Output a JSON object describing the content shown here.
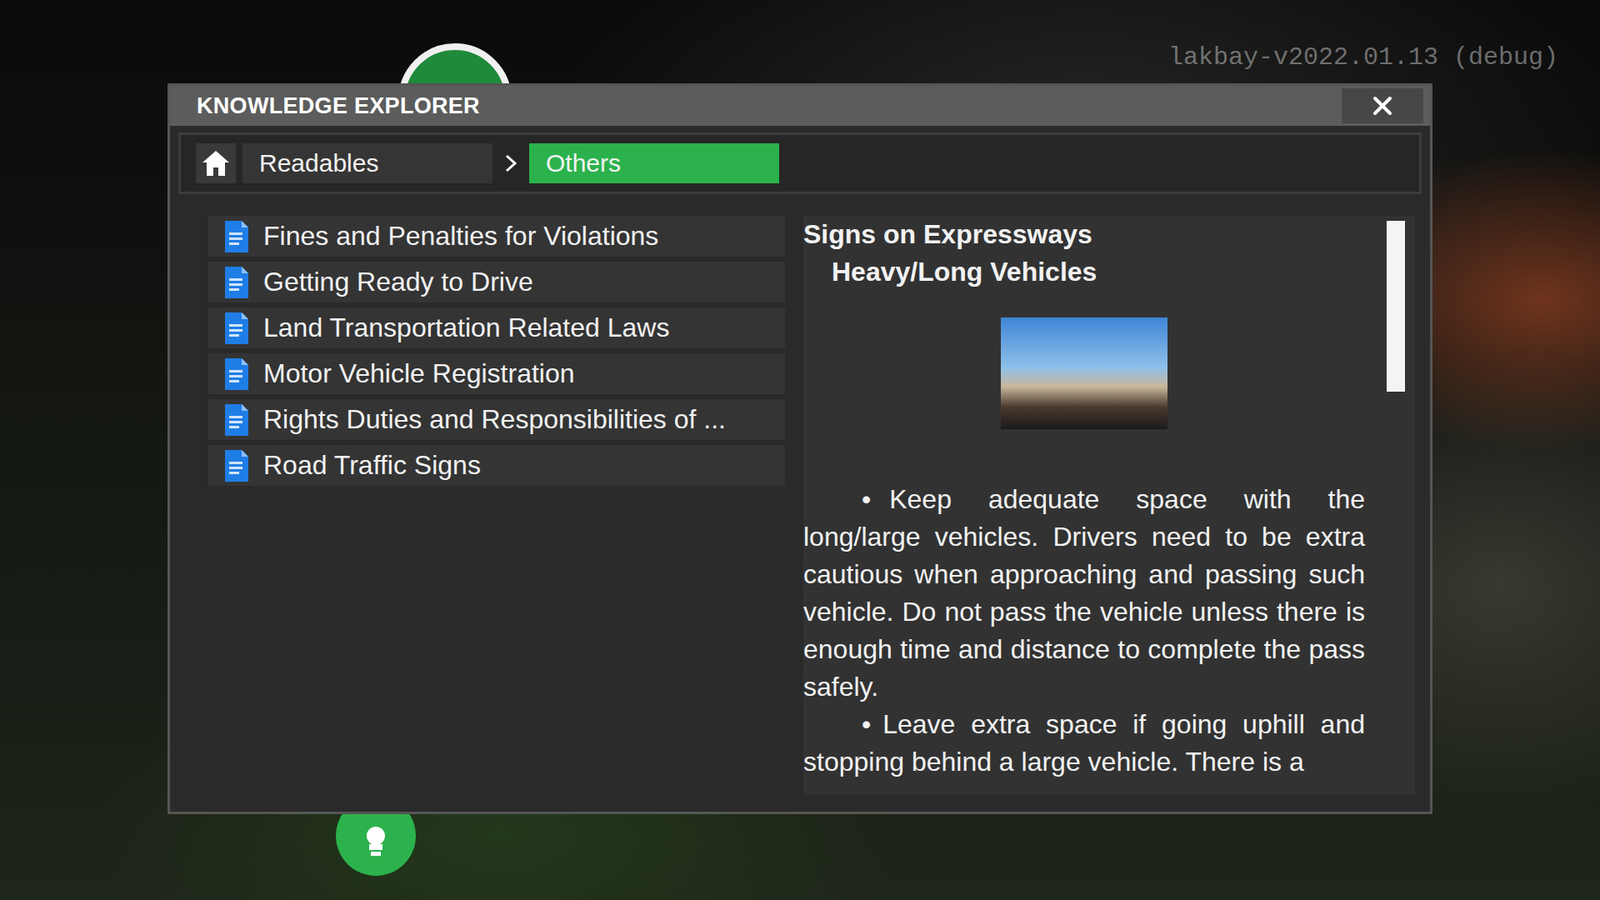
{
  "debug_label": "lakbay-v2022.01.13 (debug)",
  "window": {
    "title": "KNOWLEDGE EXPLORER"
  },
  "breadcrumb": [
    {
      "label": "Readables",
      "selected": false
    },
    {
      "label": "Others",
      "selected": true
    }
  ],
  "documents": [
    {
      "title": "Fines and Penalties for Violations",
      "selected": false
    },
    {
      "title": "Getting Ready to Drive",
      "selected": false
    },
    {
      "title": "Land Transportation Related Laws",
      "selected": false
    },
    {
      "title": "Motor Vehicle Registration",
      "selected": false
    },
    {
      "title": "Rights Duties and Responsibilities of ...",
      "selected": false
    },
    {
      "title": "Road Traffic Signs",
      "selected": false
    }
  ],
  "article": {
    "title": "Signs on Expressways",
    "subtitle": "Heavy/Long Vehicles",
    "paragraphs": [
      {
        "bullet": "•",
        "text": "Keep adequate space with the long/large vehicles. Drivers need to be extra cautious when approaching and passing such vehicle. Do not pass the vehicle unless there is enough time and distance to complete the pass safely."
      },
      {
        "bullet": "•",
        "text": "Leave extra space if going uphill and stopping behind a large vehicle. There is a"
      }
    ]
  },
  "scroll": {
    "level": 0.3
  }
}
